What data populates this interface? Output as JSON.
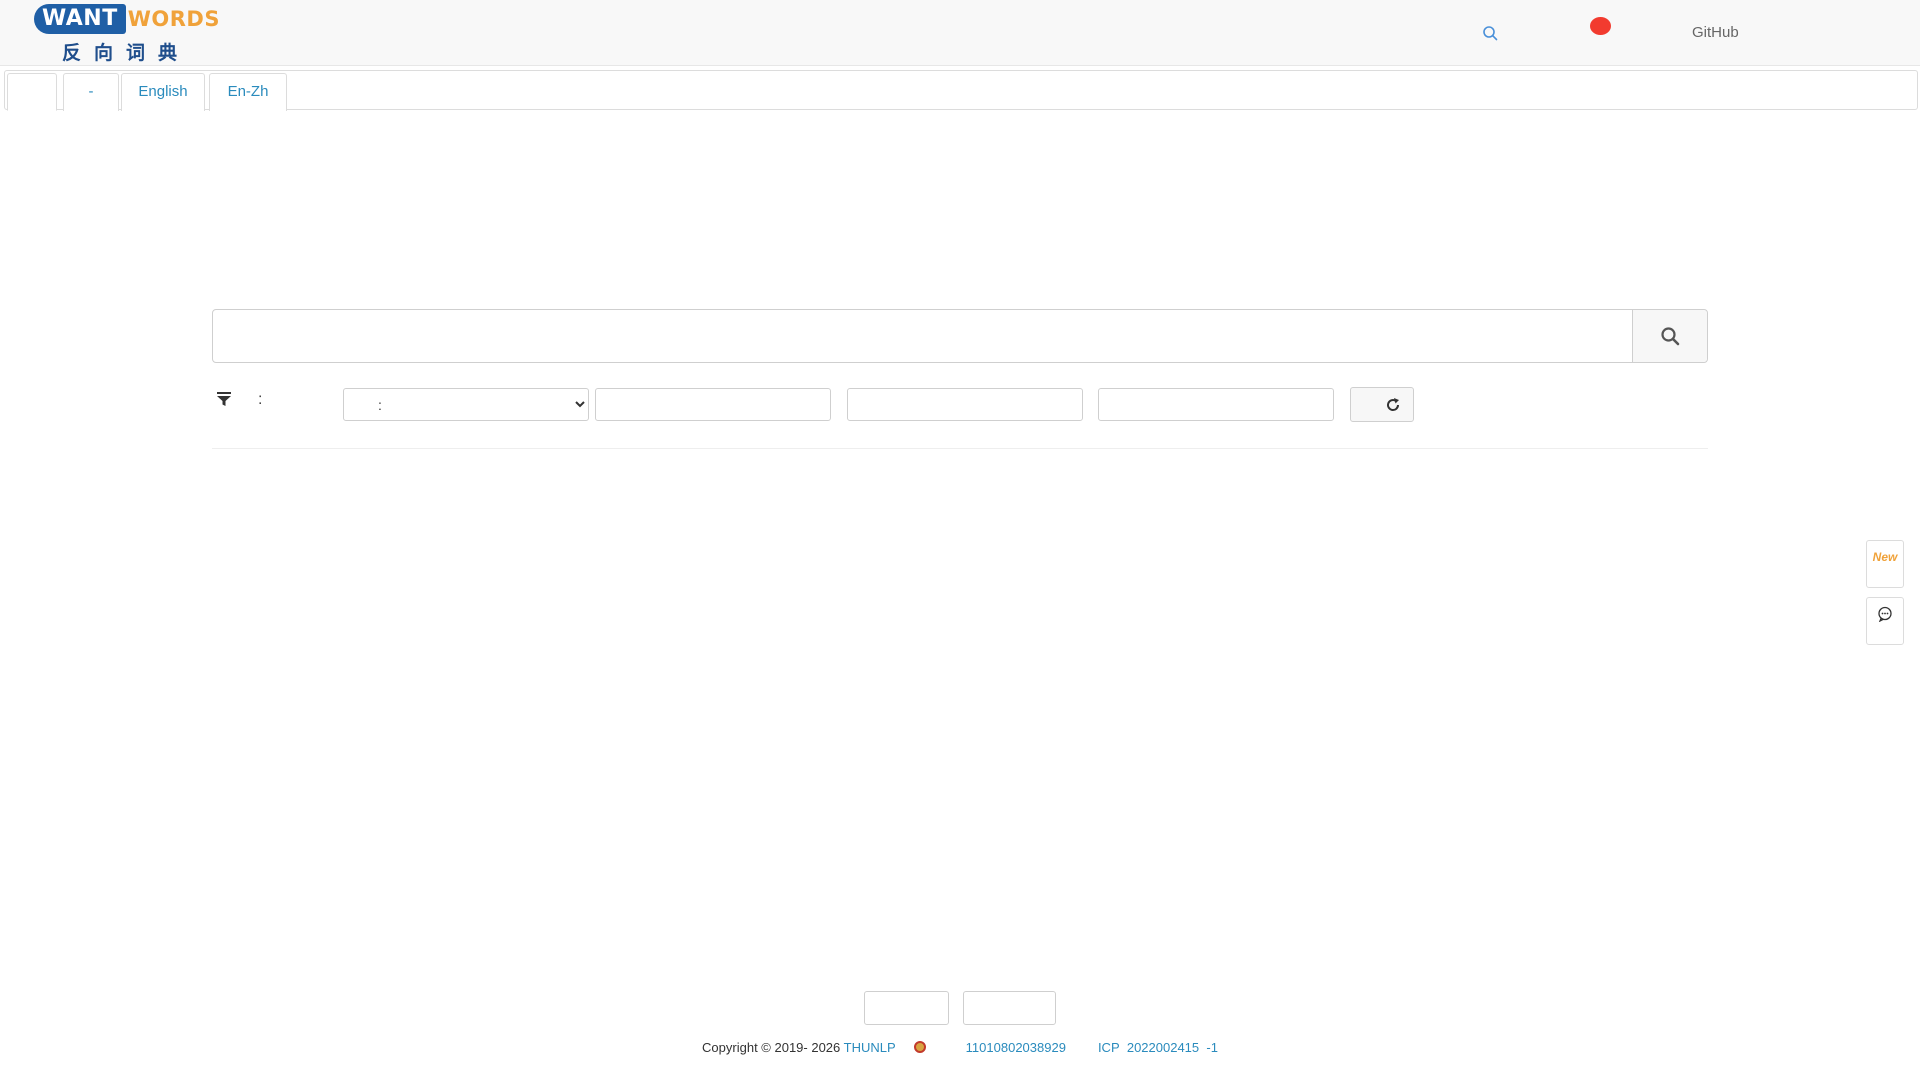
{
  "logo": {
    "want": "WANT",
    "words": "WORDS",
    "chinese": "反向词典"
  },
  "nav": {
    "github": "GitHub",
    "icons": [
      "search-icon",
      "red-dot-icon"
    ]
  },
  "tabs": [
    {
      "label": "",
      "active": true
    },
    {
      "label": "-",
      "active": false
    },
    {
      "label": "English",
      "active": false
    },
    {
      "label": "En-Zh",
      "active": false
    }
  ],
  "search": {
    "value": "",
    "placeholder": "",
    "button_icon": "magnifier-icon"
  },
  "filter": {
    "icon": "filter-icon",
    "colon": ":",
    "select_option": ":",
    "inputs": [
      "",
      "",
      ""
    ],
    "refresh_icon": "refresh-icon"
  },
  "float": {
    "new_label": "New",
    "chat_icon": "chat-icon"
  },
  "footer": {
    "buttons": [
      "",
      ""
    ],
    "copyright": "Copyright © 2019- 2026 ",
    "org": "THUNLP",
    "police_record": "11010802038929",
    "icp_prefix": "ICP",
    "icp_number": "2022002415",
    "icp_suffix": "-1"
  },
  "colors": {
    "accent_blue": "#2a8bbd",
    "logo_blue": "#1f5fa6",
    "logo_orange": "#f0a23a",
    "red_dot": "#f23b2f"
  }
}
